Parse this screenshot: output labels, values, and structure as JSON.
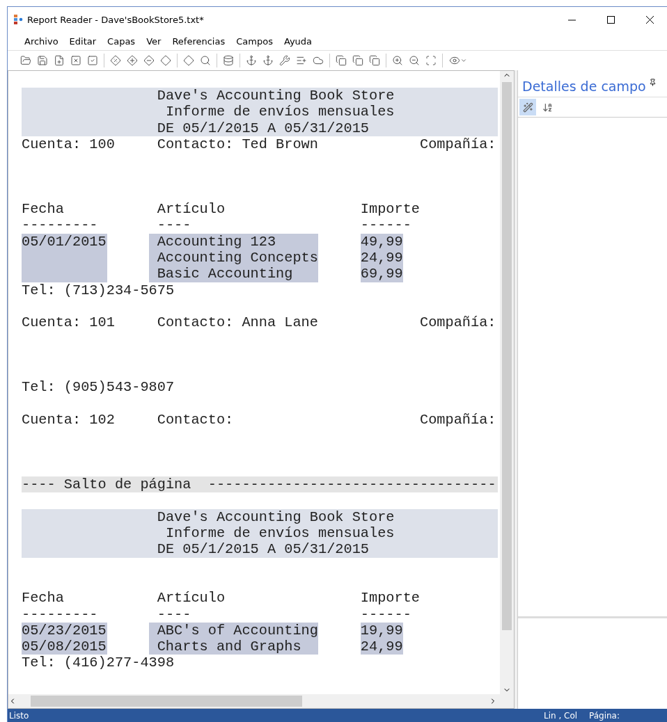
{
  "window": {
    "title": "Report Reader - Dave'sBookStore5.txt*"
  },
  "menu": [
    "Archivo",
    "Editar",
    "Capas",
    "Ver",
    "Referencias",
    "Campos",
    "Ayuda"
  ],
  "report": [
    {
      "kind": "header",
      "lines": [
        "Dave's Accounting Book Store",
        "Informe de envíos mensuales",
        "DE 05/1/2015 A 05/31/2015"
      ]
    },
    {
      "kind": "account",
      "cuenta": "Cuenta: 100",
      "contacto": "Contacto: Ted Brown",
      "compania": "Compañía:"
    },
    {
      "kind": "blank"
    },
    {
      "kind": "blank"
    },
    {
      "kind": "blank"
    },
    {
      "kind": "columns",
      "headers": [
        "Fecha",
        "Artículo",
        "Importe"
      ],
      "rules": [
        "---------",
        "----",
        "------"
      ]
    },
    {
      "kind": "items",
      "groups": [
        {
          "date": "05/01/2015",
          "lines": [
            {
              "article": "Accounting 123",
              "amount": "49,99"
            },
            {
              "article": "Accounting Concepts",
              "amount": "24,99"
            },
            {
              "article": "Basic Accounting",
              "amount": "69,99"
            }
          ]
        }
      ]
    },
    {
      "kind": "tel",
      "text": "Tel: (713)234-5675"
    },
    {
      "kind": "blank"
    },
    {
      "kind": "account",
      "cuenta": "Cuenta: 101",
      "contacto": "Contacto: Anna Lane",
      "compania": "Compañía:"
    },
    {
      "kind": "blank"
    },
    {
      "kind": "blank"
    },
    {
      "kind": "blank"
    },
    {
      "kind": "tel",
      "text": "Tel: (905)543-9807"
    },
    {
      "kind": "blank"
    },
    {
      "kind": "account",
      "cuenta": "Cuenta: 102",
      "contacto": "Contacto:",
      "compania": "Compañía:"
    },
    {
      "kind": "blank"
    },
    {
      "kind": "blank"
    },
    {
      "kind": "blank"
    },
    {
      "kind": "page_break",
      "text": "---- Salto de página  ----------------------------------"
    },
    {
      "kind": "blank"
    },
    {
      "kind": "header",
      "lines": [
        "Dave's Accounting Book Store",
        "Informe de envíos mensuales",
        "DE 05/1/2015 A 05/31/2015"
      ]
    },
    {
      "kind": "blank"
    },
    {
      "kind": "blank"
    },
    {
      "kind": "columns",
      "headers": [
        "Fecha",
        "Artículo",
        "Importe"
      ],
      "rules": [
        "---------",
        "----",
        "------"
      ]
    },
    {
      "kind": "items",
      "groups": [
        {
          "date": "05/23/2015",
          "lines": [
            {
              "article": "ABC's of Accounting",
              "amount": "19,99"
            }
          ]
        },
        {
          "date": "05/08/2015",
          "lines": [
            {
              "article": "Charts and Graphs",
              "amount": "24,99"
            }
          ]
        }
      ]
    },
    {
      "kind": "tel",
      "text": "Tel: (416)277-4398"
    }
  ],
  "side_panel": {
    "title": "Detalles de campo"
  },
  "status_bar": {
    "left": "Listo",
    "position": "Lin , Col",
    "page": "Página:"
  }
}
